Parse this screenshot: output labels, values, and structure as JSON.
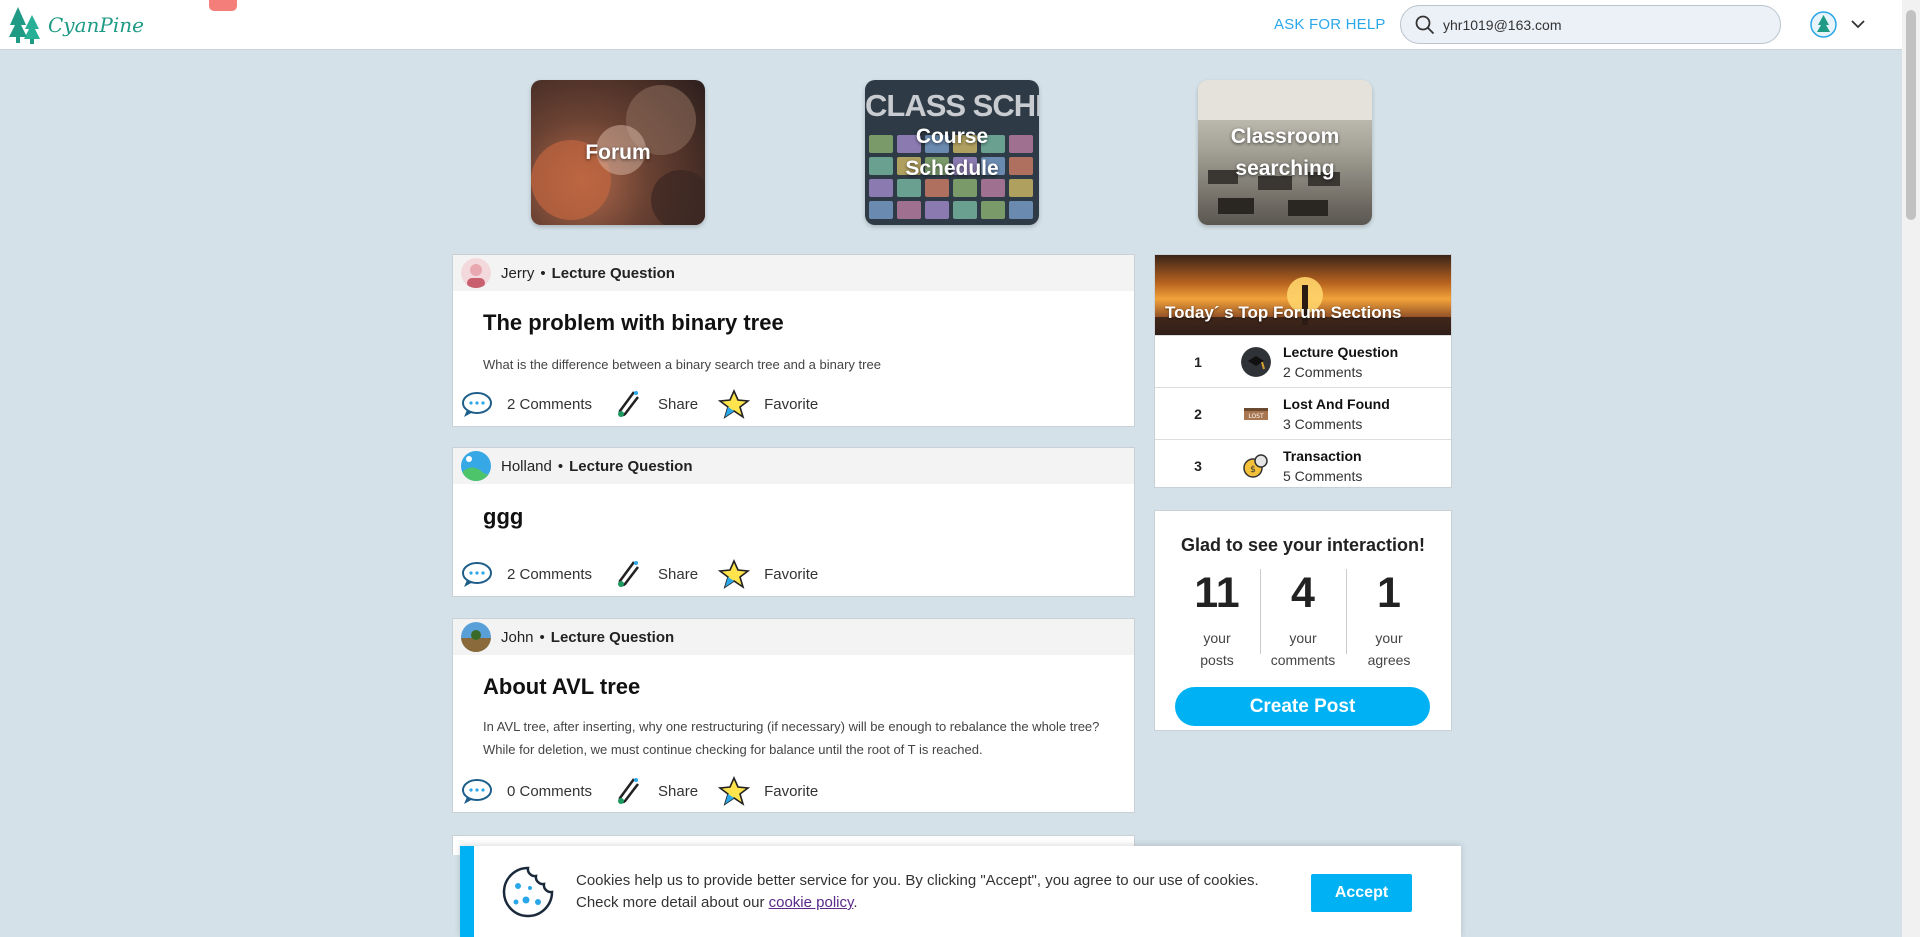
{
  "header": {
    "logo_text": "CyanPine",
    "help_label": "ASK FOR HELP",
    "search_value": "yhr1019@163.com"
  },
  "tiles": [
    {
      "label": "Forum"
    },
    {
      "label": "Course Schedule",
      "image_heading": "CLASS SCHEDULE"
    },
    {
      "label": "Classroom searching"
    }
  ],
  "posts": [
    {
      "author": "Jerry",
      "section": "Lecture Question",
      "title": "The problem with binary tree",
      "body": "What is the difference between a binary search tree and a binary tree",
      "comments": "2 Comments",
      "share": "Share",
      "favorite": "Favorite"
    },
    {
      "author": "Holland",
      "section": "Lecture Question",
      "title": "ggg",
      "body": "",
      "comments": "2 Comments",
      "share": "Share",
      "favorite": "Favorite"
    },
    {
      "author": "John",
      "section": "Lecture Question",
      "title": "About AVL tree",
      "body": "In AVL tree, after inserting, why one restructuring (if necessary) will be enough to rebalance the whole tree? While for deletion, we must continue checking for balance until the root of T is reached.",
      "comments": "0 Comments",
      "share": "Share",
      "favorite": "Favorite"
    }
  ],
  "top_sections": {
    "title": "Today´ s Top Forum Sections",
    "items": [
      {
        "rank": "1",
        "name": "Lecture Question",
        "count": "2 Comments"
      },
      {
        "rank": "2",
        "name": "Lost And Found",
        "count": "3 Comments"
      },
      {
        "rank": "3",
        "name": "Transaction",
        "count": "5 Comments"
      }
    ]
  },
  "stats": {
    "title": "Glad to see your interaction!",
    "items": [
      {
        "number": "11",
        "label_1": "your",
        "label_2": "posts"
      },
      {
        "number": "4",
        "label_1": "your",
        "label_2": "comments"
      },
      {
        "number": "1",
        "label_1": "your",
        "label_2": "agrees"
      }
    ],
    "create_label": "Create Post"
  },
  "cookie": {
    "text": "Cookies help us to provide better service for you. By clicking \"Accept\", you agree to our use of cookies. Check more detail about our ",
    "link": "cookie policy",
    "suffix": ".",
    "accept_label": "Accept"
  },
  "colors": {
    "accent": "#00b2f3",
    "help_link": "#2aa7e8",
    "background": "#d4e1e8",
    "logo": "#1e9a85"
  },
  "icons": [
    "tree-logo-icon",
    "search-icon",
    "user-avatar-icon",
    "chevron-down-icon",
    "comment-icon",
    "share-icon",
    "star-icon",
    "cookie-icon"
  ]
}
